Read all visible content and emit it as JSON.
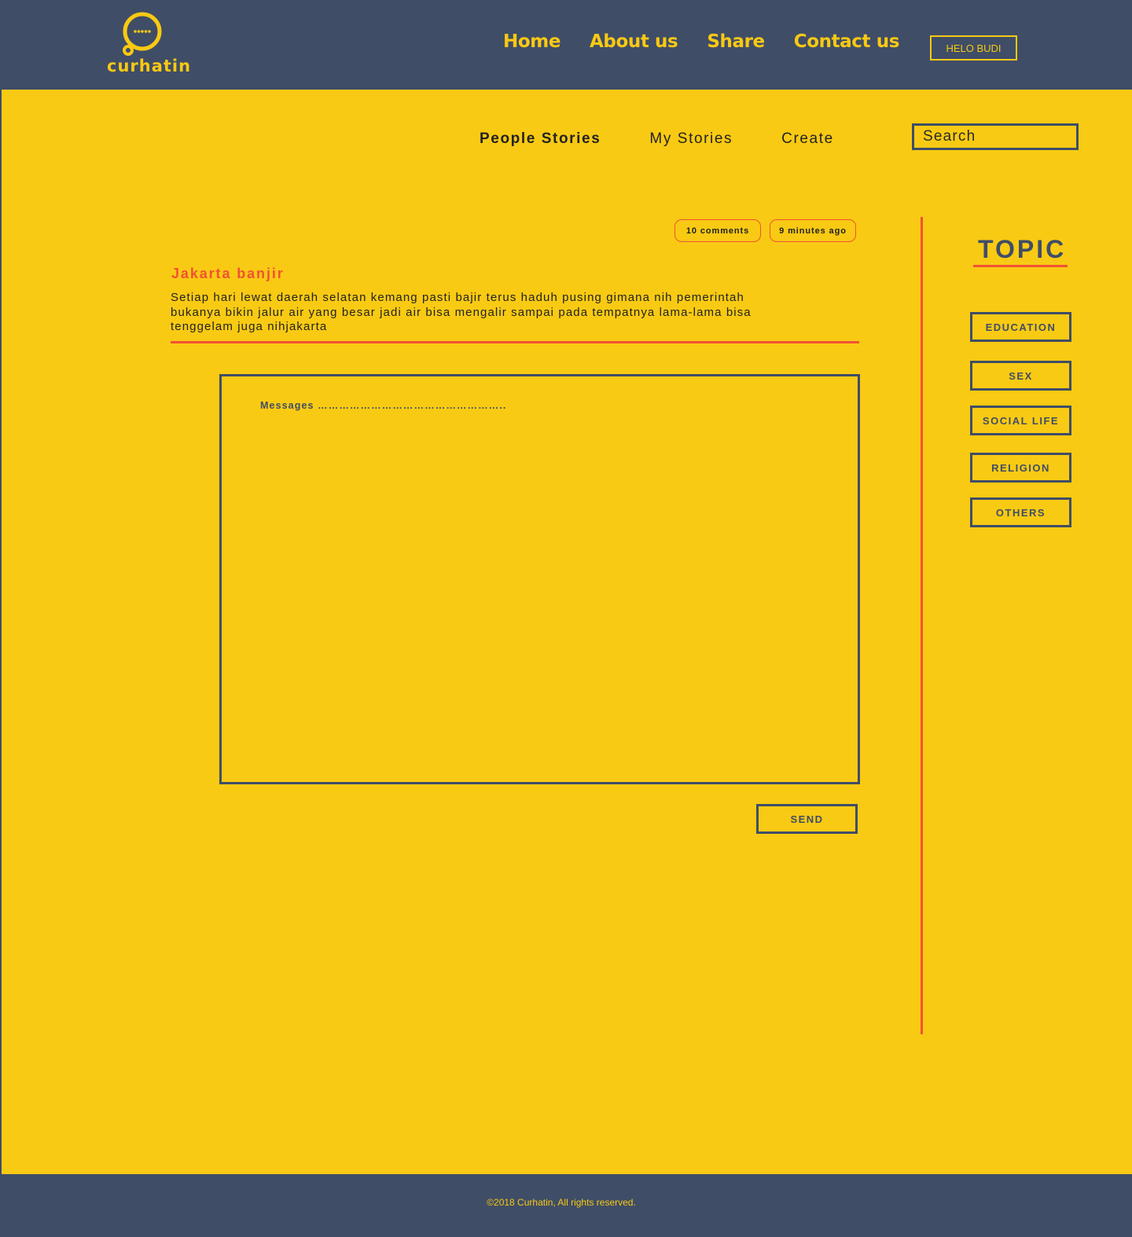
{
  "brand": {
    "name": "curhatin"
  },
  "topnav": {
    "items": [
      "Home",
      "About us",
      "Share",
      "Contact us"
    ]
  },
  "user": {
    "label": "HELO BUDI"
  },
  "subnav": {
    "items": [
      "People Stories",
      "My Stories",
      "Create"
    ],
    "active": "People Stories"
  },
  "search": {
    "placeholder": "Search"
  },
  "story": {
    "comments": "10 comments",
    "time": "9 minutes ago",
    "title": "Jakarta banjir",
    "body": "Setiap hari lewat daerah selatan kemang pasti bajir terus haduh pusing gimana nih pemerintah bukanya bikin jalur air yang besar jadi air bisa mengalir sampai pada tempatnya lama-lama bisa tenggelam juga nihjakarta"
  },
  "message": {
    "label": "Messages ……………………………………………..",
    "send_label": "SEND"
  },
  "sidebar": {
    "title": "TOPIC",
    "topics": [
      "EDUCATION",
      "SEX",
      "SOCIAL LIFE",
      "RELIGION",
      "OTHERS"
    ]
  },
  "footer": {
    "copyright": "©2018 Curhatin, All rights reserved."
  },
  "colors": {
    "navy": "#3f4d67",
    "yellow": "#f9ca13",
    "accent": "#f05235"
  }
}
